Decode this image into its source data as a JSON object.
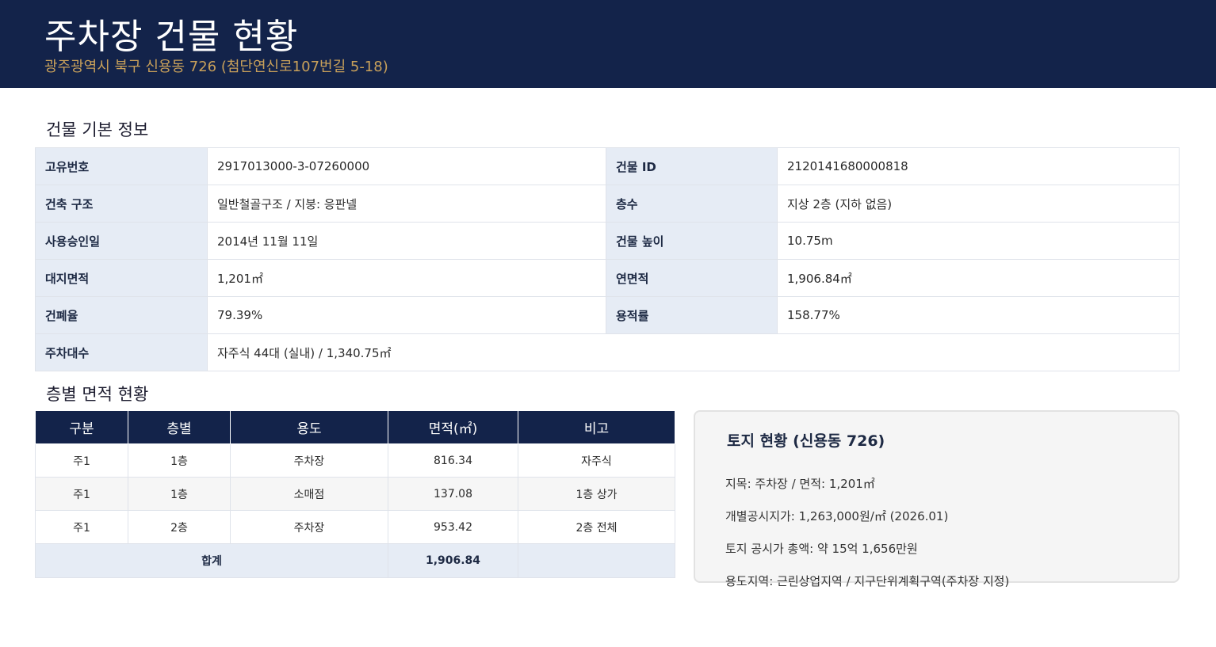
{
  "header": {
    "title": "주차장 건물 현황",
    "subtitle": "광주광역시 북구 신용동 726 (첨단연신로107번길 5-18)"
  },
  "basic_info": {
    "section_title": "건물 기본 정보",
    "rows": [
      {
        "label1": "고유번호",
        "value1": "2917013000-3-07260000",
        "label2": "건물 ID",
        "value2": "2120141680000818"
      },
      {
        "label1": "건축 구조",
        "value1": "일반철골구조 / 지붕: 응판넬",
        "label2": "층수",
        "value2": "지상 2층 (지하 없음)"
      },
      {
        "label1": "사용승인일",
        "value1": "2014년 11월 11일",
        "label2": "건물 높이",
        "value2": "10.75m"
      },
      {
        "label1": "대지면적",
        "value1": "1,201㎡",
        "label2": "연면적",
        "value2": "1,906.84㎡"
      },
      {
        "label1": "건폐율",
        "value1": "79.39%",
        "label2": "용적률",
        "value2": "158.77%"
      }
    ],
    "parking": {
      "label": "주차대수",
      "value": "자주식 44대 (실내) / 1,340.75㎡"
    }
  },
  "floors": {
    "section_title": "층별 면적 현황",
    "headers": [
      "구분",
      "층별",
      "용도",
      "면적(㎡)",
      "비고"
    ],
    "rows": [
      [
        "주1",
        "1층",
        "주차장",
        "816.34",
        "자주식"
      ],
      [
        "주1",
        "1층",
        "소매점",
        "137.08",
        "1층 상가"
      ],
      [
        "주1",
        "2층",
        "주차장",
        "953.42",
        "2층 전체"
      ]
    ],
    "total_label": "합계",
    "total_value": "1,906.84"
  },
  "land": {
    "title": "토지 현황 (신용동 726)",
    "lines": [
      "지목: 주차장 / 면적: 1,201㎡",
      "개별공시지가: 1,263,000원/㎡ (2026.01)",
      "토지 공시가 총액: 약 15억 1,656만원",
      "용도지역: 근린상업지역 / 지구단위계획구역(주차장 지정)"
    ]
  }
}
